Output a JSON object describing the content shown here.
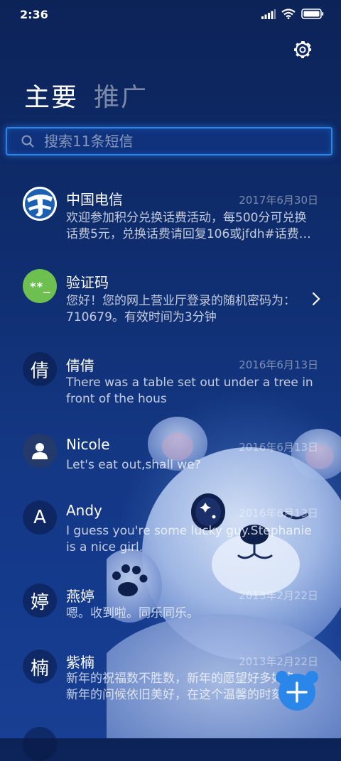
{
  "status_bar": {
    "time": "2:36"
  },
  "tabs": {
    "primary": "主要",
    "promotions": "推广"
  },
  "search": {
    "placeholder": "搜索11条短信"
  },
  "messages": [
    {
      "sender": "中国电信",
      "date": "2017年6月30日",
      "preview": "欢迎参加积分兑换话费活动，每500分可兑换话费5元，兑换话费请回复106或jfdh#话费…"
    },
    {
      "sender": "验证码",
      "date": "",
      "avatar_text": "**_",
      "preview": "您好！您的网上营业厅登录的随机密码为：710679。有效时间为3分钟"
    },
    {
      "sender": "倩倩",
      "date": "2016年6月13日",
      "avatar_text": "倩",
      "preview": "There was a table set out under a tree in front of the hous"
    },
    {
      "sender": "Nicole",
      "date": "2016年6月13日",
      "preview": "Let's eat out,shall we?"
    },
    {
      "sender": "Andy",
      "date": "2016年6月13日",
      "avatar_text": "A",
      "preview": "I guess you're some lucky guy.Stephanie is a nice girl."
    },
    {
      "sender": "燕婷",
      "date": "2013年2月22日",
      "avatar_text": "婷",
      "preview": "嗯。收到啦。同乐同乐。"
    },
    {
      "sender": "紫楠",
      "date": "2013年2月22日",
      "avatar_text": "楠",
      "preview": "新年的祝福数不胜数，新年的愿望好多好多，新年的问候依旧美好，在这个温馨的时刻"
    }
  ],
  "icons": {
    "settings": "gear-icon",
    "search": "search-icon",
    "compose": "plus-icon"
  },
  "colors": {
    "accent": "#2a86e8",
    "background": "#0f2d6f",
    "verify_avatar": "#6dc04f"
  }
}
